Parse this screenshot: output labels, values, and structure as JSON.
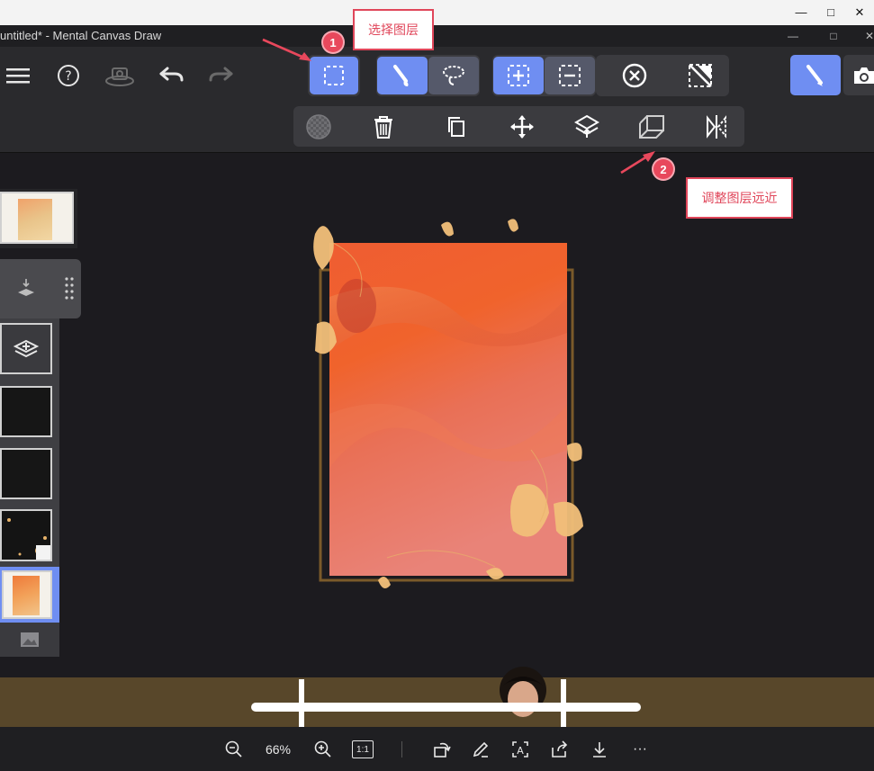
{
  "window": {
    "minimize_label": "—",
    "maximize_label": "□",
    "close_label": "✕"
  },
  "app": {
    "title": "untitled* - Mental Canvas Draw",
    "minimize_label": "—",
    "maximize_label": "□",
    "close_label": "✕"
  },
  "toolbar": {
    "icons": [
      "menu-icon",
      "help-icon",
      "camera-orbit-icon",
      "undo-icon",
      "redo-icon",
      "select-layer-icon",
      "brush-icon",
      "lasso-icon",
      "add-selection-icon",
      "subtract-selection-icon",
      "clear-selection-icon",
      "no-fill-icon",
      "pen-tool-icon",
      "snapshot-icon"
    ]
  },
  "sub_toolbar": {
    "icons": [
      "opacity-icon",
      "delete-icon",
      "duplicate-icon",
      "move-icon",
      "layer-stack-icon",
      "depth-adjust-icon",
      "mirror-icon"
    ]
  },
  "annotations": {
    "step1": {
      "number": "1",
      "text": "选择图层"
    },
    "step2": {
      "number": "2",
      "text": "调整图层远近"
    }
  },
  "accent": "#6f8ef2",
  "annotation_color": "#e0465a",
  "bottom_bar": {
    "zoom": "66%",
    "actual_size_label": "1:1",
    "more_label": "···"
  }
}
